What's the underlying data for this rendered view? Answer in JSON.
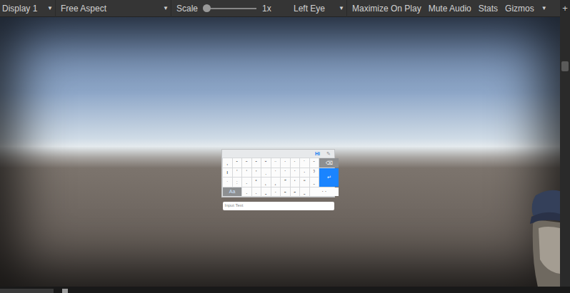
{
  "toolbar": {
    "arrow": "▼",
    "display": "Display 1",
    "aspect": "Free Aspect",
    "scale": {
      "label": "Scale",
      "value": "1x",
      "level": 0.0
    },
    "eye": "Left Eye",
    "toggles": [
      {
        "label": "Maximize On Play",
        "on": false
      },
      {
        "label": "Mute Audio",
        "on": false
      },
      {
        "label": "Stats",
        "on": false
      }
    ],
    "gizmos": "Gizmos",
    "add": "+"
  },
  "keyboard": {
    "header": {
      "language": "Hi",
      "icon": "✎"
    },
    "keys": [
      {
        "label": ",",
        "kind": "char"
      },
      {
        "label": "ˆ",
        "kind": "char"
      },
      {
        "label": "˜",
        "kind": "char"
      },
      {
        "label": "ˇ",
        "kind": "char"
      },
      {
        "label": "˘",
        "kind": "char"
      },
      {
        "label": "¨",
        "kind": "char"
      },
      {
        "label": "`",
        "kind": "char"
      },
      {
        "label": "´",
        "kind": "char"
      },
      {
        "label": "˙",
        "kind": "char"
      },
      {
        "label": "ˉ",
        "kind": "char"
      },
      {
        "label": "⌫",
        "kind": "backspace"
      },
      {
        "label": "ı",
        "kind": "char"
      },
      {
        "label": "ʼ",
        "kind": "char"
      },
      {
        "label": "ʻ",
        "kind": "char"
      },
      {
        "label": "'",
        "kind": "char"
      },
      {
        "label": "ˌ",
        "kind": "char"
      },
      {
        "label": "ˈ",
        "kind": "char"
      },
      {
        "label": "ˋ",
        "kind": "char"
      },
      {
        "label": "ˊ",
        "kind": "char"
      },
      {
        "label": "·",
        "kind": "char"
      },
      {
        "label": "ˀ",
        "kind": "char"
      },
      {
        "label": "↵",
        "kind": "enter"
      },
      {
        "label": "ˑ",
        "kind": "char"
      },
      {
        "label": "ː",
        "kind": "char"
      },
      {
        "label": ".",
        "kind": "char"
      },
      {
        "label": "˚",
        "kind": "char"
      },
      {
        "label": "˛",
        "kind": "char"
      },
      {
        "label": "¸",
        "kind": "char"
      },
      {
        "label": "˝",
        "kind": "char"
      },
      {
        "label": "ʹ",
        "kind": "char"
      },
      {
        "label": "ʺ",
        "kind": "char"
      },
      {
        "label": "ˍ",
        "kind": "char"
      },
      {
        "label": "Aa",
        "kind": "shift"
      },
      {
        "label": "ˏ",
        "kind": "char"
      },
      {
        "label": "ˎ",
        "kind": "char"
      },
      {
        "label": "ˬ",
        "kind": "char"
      },
      {
        "label": "˴",
        "kind": "char"
      },
      {
        "label": "˵",
        "kind": "char"
      },
      {
        "label": "˶",
        "kind": "char"
      },
      {
        "label": "˷",
        "kind": "char"
      },
      {
        "label": "· ·",
        "kind": "space"
      }
    ],
    "input": {
      "placeholder": "Input Text"
    }
  }
}
